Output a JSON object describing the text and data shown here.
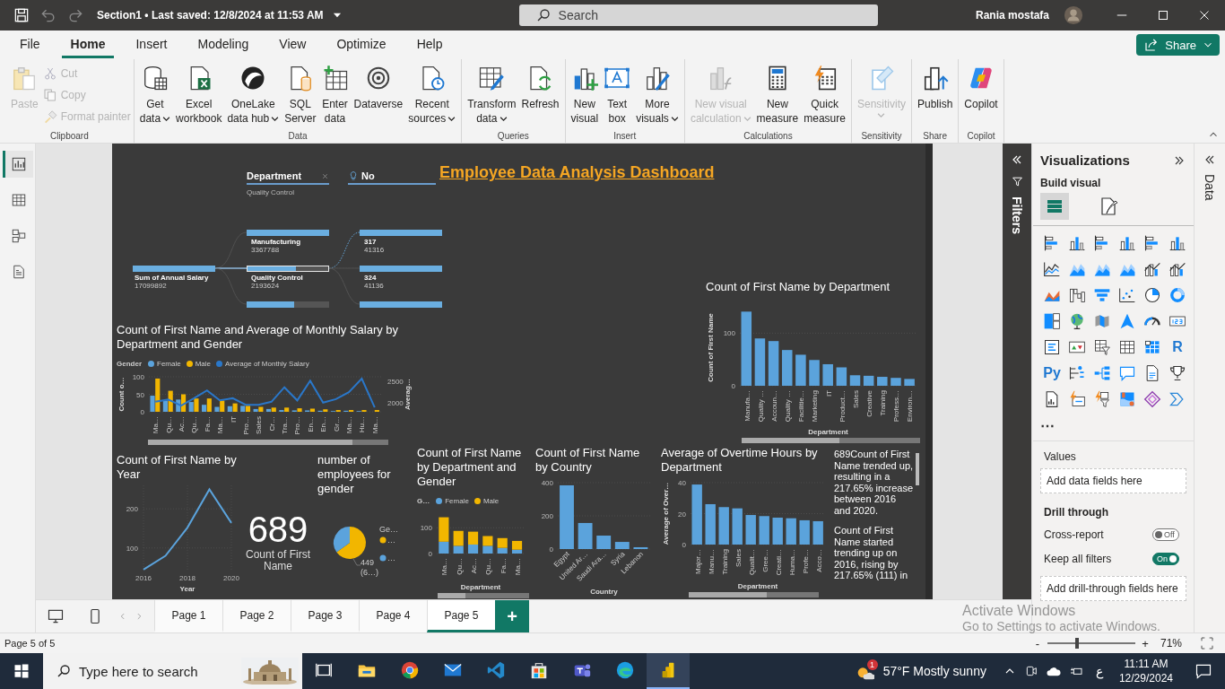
{
  "title_bar": {
    "document": "Section1",
    "separator": "•",
    "saved": "Last saved: 12/8/2024 at 11:53 AM",
    "search": {
      "placeholder": "Search"
    },
    "user": "Rania mostafa"
  },
  "menu_tabs": [
    {
      "label": "File",
      "selected": false
    },
    {
      "label": "Home",
      "selected": true
    },
    {
      "label": "Insert",
      "selected": false
    },
    {
      "label": "Modeling",
      "selected": false
    },
    {
      "label": "View",
      "selected": false
    },
    {
      "label": "Optimize",
      "selected": false
    },
    {
      "label": "Help",
      "selected": false
    }
  ],
  "share_button": {
    "label": "Share"
  },
  "ribbon": [
    {
      "label": "Clipboard",
      "items": [
        {
          "kind": "large",
          "lines": [
            "Paste"
          ],
          "dropdown": false,
          "disabled": true
        },
        {
          "kind": "small",
          "lines": [
            "Cut"
          ],
          "dropdown": false,
          "disabled": true
        },
        {
          "kind": "small",
          "lines": [
            "Copy"
          ],
          "dropdown": false,
          "disabled": true
        },
        {
          "kind": "small",
          "lines": [
            "Format painter"
          ],
          "dropdown": false,
          "disabled": true
        }
      ]
    },
    {
      "label": "Data",
      "items": [
        {
          "kind": "large",
          "lines": [
            "Get",
            "data"
          ],
          "dropdown": true,
          "disabled": false
        },
        {
          "kind": "large",
          "lines": [
            "Excel",
            "workbook"
          ],
          "dropdown": false,
          "disabled": false
        },
        {
          "kind": "large",
          "lines": [
            "OneLake",
            "data hub"
          ],
          "dropdown": true,
          "disabled": false
        },
        {
          "kind": "large",
          "lines": [
            "SQL",
            "Server"
          ],
          "dropdown": false,
          "disabled": false
        },
        {
          "kind": "large",
          "lines": [
            "Enter",
            "data"
          ],
          "dropdown": false,
          "disabled": false
        },
        {
          "kind": "large",
          "lines": [
            "Dataverse"
          ],
          "dropdown": false,
          "disabled": false
        },
        {
          "kind": "large",
          "lines": [
            "Recent",
            "sources"
          ],
          "dropdown": true,
          "disabled": false
        }
      ]
    },
    {
      "label": "Queries",
      "items": [
        {
          "kind": "large",
          "lines": [
            "Transform",
            "data"
          ],
          "dropdown": true,
          "disabled": false
        },
        {
          "kind": "large",
          "lines": [
            "Refresh"
          ],
          "dropdown": false,
          "disabled": false
        }
      ]
    },
    {
      "label": "Insert",
      "items": [
        {
          "kind": "large",
          "lines": [
            "New",
            "visual"
          ],
          "dropdown": false,
          "disabled": false
        },
        {
          "kind": "large",
          "lines": [
            "Text",
            "box"
          ],
          "dropdown": false,
          "disabled": false
        },
        {
          "kind": "large",
          "lines": [
            "More",
            "visuals"
          ],
          "dropdown": true,
          "disabled": false
        }
      ]
    },
    {
      "label": "Calculations",
      "items": [
        {
          "kind": "large",
          "lines": [
            "New visual",
            "calculation"
          ],
          "dropdown": true,
          "disabled": true
        },
        {
          "kind": "large",
          "lines": [
            "New",
            "measure"
          ],
          "dropdown": false,
          "disabled": false
        },
        {
          "kind": "large",
          "lines": [
            "Quick",
            "measure"
          ],
          "dropdown": false,
          "disabled": false
        }
      ]
    },
    {
      "label": "Sensitivity",
      "items": [
        {
          "kind": "large",
          "lines": [
            "Sensitivity"
          ],
          "dropdown": true,
          "disabled": true
        }
      ]
    },
    {
      "label": "Share",
      "items": [
        {
          "kind": "large",
          "lines": [
            "Publish"
          ],
          "dropdown": false,
          "disabled": false
        }
      ]
    },
    {
      "label": "Copilot",
      "items": [
        {
          "kind": "large",
          "lines": [
            "Copilot"
          ],
          "dropdown": false,
          "disabled": false
        }
      ]
    }
  ],
  "views": [
    {
      "selected": true
    },
    {
      "selected": false
    },
    {
      "selected": false
    },
    {
      "selected": false
    }
  ],
  "report": {
    "slicers": [
      {
        "kind": "list",
        "title": "Department",
        "value": "Quality Control",
        "clearable": true
      },
      {
        "kind": "bulb",
        "title": "No"
      }
    ],
    "title": "Employee Data Analysis Dashboard",
    "decomposition_tree": {
      "root": {
        "label": "Sum of Annual Salary",
        "value": "17099892",
        "level": 1
      },
      "columns": [
        {
          "items": [
            {
              "label": "Manufacturing",
              "value": "3367788",
              "level": 1,
              "selected": false
            },
            {
              "label": "Quality Control",
              "value": "2193624",
              "level": 0.6,
              "selected": true
            },
            {
              "level": 0.58,
              "selected": false
            }
          ]
        },
        {
          "items": [
            {
              "label": "317",
              "value": "41316",
              "level": 1
            },
            {
              "label": "324",
              "value": "41136",
              "level": 1
            },
            {
              "level": 1
            }
          ]
        }
      ]
    },
    "visuals": [
      {
        "kind": "chart",
        "title": "Count of First Name by Department",
        "chart_data": {
          "type": "bar",
          "grid": true,
          "ylabel": "Count of First Name",
          "xlabel": "Department",
          "categories": [
            "Manufa…",
            "Quality …",
            "Accoun…",
            "Quality …",
            "Facilitie…",
            "Marketing",
            "IT",
            "Product…",
            "Sales",
            "Creative",
            "Training",
            "Profess…",
            "Environ…"
          ],
          "series": [
            {
              "color": "#5ba3dc",
              "values": [
                141,
                90,
                85,
                68,
                59,
                49,
                41,
                35,
                20,
                19,
                17,
                15,
                13
              ]
            }
          ],
          "ylim": [
            0,
            145
          ],
          "yticks": [
            0,
            100
          ]
        }
      },
      {
        "kind": "chart",
        "title": "Count of First Name and Average of Monthly Salary by Department and Gender",
        "legend": {
          "title": "Gender"
        },
        "chart_data": {
          "type": "bar",
          "grid": true,
          "ylabel": "Count o…",
          "y2label": "Averag…",
          "categories": [
            "Ma…",
            "Qu…",
            "Ac…",
            "Qu…",
            "Fa…",
            "Ma…",
            "IT",
            "Pro…",
            "Sales",
            "Cr…",
            "Tra…",
            "Pro…",
            "En…",
            "En…",
            "Gr…",
            "Ma…",
            "Hu…",
            "Ma…"
          ],
          "series": [
            {
              "name": "Female",
              "color": "#5ba3dc",
              "values": [
                46,
                32,
                35,
                28,
                20,
                14,
                16,
                17,
                8,
                8,
                5,
                4,
                4,
                3,
                2,
                3,
                2,
                null
              ]
            },
            {
              "name": "Male",
              "color": "#f2b600",
              "values": [
                95,
                60,
                50,
                38,
                38,
                32,
                24,
                17,
                14,
                12,
                12,
                10,
                9,
                7,
                5,
                5,
                5,
                5
              ]
            },
            {
              "name": "Average of Monthly Salary",
              "type": "line",
              "axis": "y2",
              "color": "#2a77c9",
              "values": [
                2030,
                2080,
                1940,
                2110,
                2290,
                2060,
                2110,
                1960,
                1960,
                2030,
                2360,
                2060,
                2510,
                2010,
                2090,
                2250,
                2560,
                1900
              ]
            }
          ],
          "ylim": [
            0,
            100
          ],
          "yticks": [
            0,
            50,
            100
          ],
          "y2lim": [
            1800,
            2600
          ],
          "y2ticks": [
            2000,
            2500
          ]
        }
      },
      {
        "kind": "chart",
        "title": "Count of First Name by Year",
        "chart_data": {
          "type": "line",
          "grid": true,
          "xlabel": "Year",
          "x": [
            2016,
            2017,
            2018,
            2019,
            2020
          ],
          "series": [
            {
              "color": "#5ba3dc",
              "values": [
                45,
                80,
                152,
                250,
                164
              ]
            }
          ],
          "xlim": [
            2016,
            2020
          ],
          "ylim": [
            40,
            260
          ],
          "xticks": [
            2016,
            2018,
            2020
          ],
          "yticks": [
            100,
            200
          ]
        }
      },
      {
        "kind": "card",
        "value": "689",
        "label": "Count of First Name"
      },
      {
        "kind": "chart",
        "title": "number of employees for gender",
        "legend": {
          "title": "Ge…"
        },
        "chart_data": {
          "type": "pie",
          "categories": [
            "…",
            "…"
          ],
          "values": [
            65.17,
            34.83
          ],
          "colors": [
            "#f2b600",
            "#5ba3dc"
          ],
          "annotations": [
            "449",
            "(6…)"
          ]
        }
      },
      {
        "kind": "chart",
        "title": "Count of First Name by Department and Gender",
        "legend": {
          "title": "G…"
        },
        "chart_data": {
          "type": "bar",
          "grid": true,
          "stacked": true,
          "xlabel": "Department",
          "categories": [
            "Ma…",
            "Qu…",
            "Ac…",
            "Qu…",
            "Fa…",
            "Ma…"
          ],
          "series": [
            {
              "name": "Female",
              "color": "#5ba3dc",
              "values": [
                46,
                30,
                35,
                30,
                22,
                15
              ]
            },
            {
              "name": "Male",
              "color": "#f2b600",
              "values": [
                95,
                58,
                50,
                38,
                38,
                34
              ]
            }
          ],
          "ylim": [
            0,
            150
          ],
          "yticks": [
            0,
            100
          ]
        }
      },
      {
        "kind": "chart",
        "title": "Count of First Name by Country",
        "chart_data": {
          "type": "bar",
          "xlabel": "Country",
          "categories": [
            "Egypt",
            "United Ar…",
            "Saudi Ara…",
            "Syria",
            "Lebanon"
          ],
          "series": [
            {
              "color": "#5ba3dc",
              "values": [
                384,
                157,
                81,
                43,
                11
              ]
            }
          ],
          "grid": true,
          "ylim": [
            0,
            400
          ],
          "yticks": [
            0,
            200,
            400
          ]
        }
      },
      {
        "kind": "chart",
        "title": "Average of Overtime Hours by Department",
        "chart_data": {
          "type": "bar",
          "ylabel": "Average of Over…",
          "xlabel": "Department",
          "categories": [
            "Major…",
            "Manu…",
            "Training",
            "Sales",
            "Qualit…",
            "Gree…",
            "Creati…",
            "Huma…",
            "Profe…",
            "Acco…"
          ],
          "series": [
            {
              "color": "#5ba3dc",
              "values": [
                38.8,
                26.1,
                24.2,
                23.4,
                19.1,
                18.4,
                17.4,
                17,
                15.7,
                15.1
              ]
            }
          ],
          "grid": true,
          "ylim": [
            0,
            40
          ],
          "yticks": [
            0,
            20,
            40
          ]
        }
      },
      {
        "kind": "narrative",
        "paragraphs": [
          "689Count of First Name trended up, resulting in a 217.65% increase between 2016 and 2020.",
          "Count of First Name started trending up on 2016, rising by 217.65% (111) in"
        ]
      }
    ]
  },
  "filters_pane": {
    "label": "Filters"
  },
  "visualizations": {
    "title": "Visualizations",
    "subtitle": "Build visual",
    "tabs": [
      {
        "selected": true
      },
      {
        "selected": false
      }
    ],
    "gallery_text": [
      "R",
      "Py"
    ],
    "more": "⋯",
    "values": {
      "label": "Values",
      "well": "Add data fields here"
    },
    "drill_through": {
      "title": "Drill through",
      "toggles": [
        {
          "label": "Cross-report",
          "on": false,
          "text": "Off"
        },
        {
          "label": "Keep all filters",
          "on": true,
          "text": "On"
        }
      ],
      "well": "Add drill-through fields here"
    }
  },
  "data_pane": {
    "label": "Data"
  },
  "pages": [
    {
      "label": "Page 1",
      "selected": false
    },
    {
      "label": "Page 2",
      "selected": false
    },
    {
      "label": "Page 3",
      "selected": false
    },
    {
      "label": "Page 4",
      "selected": false
    },
    {
      "label": "Page 5",
      "selected": true
    }
  ],
  "add_page": "+",
  "status_bar": {
    "page": "Page 5 of 5",
    "zoom": {
      "minus": "-",
      "plus": "+",
      "level": 0.34,
      "value": "71%"
    }
  },
  "activation_notice": {
    "title": "Activate Windows",
    "text": "Go to Settings to activate Windows."
  },
  "taskbar": {
    "search": {
      "placeholder": "Type here to search"
    },
    "apps": [
      {
        "selected": false
      },
      {
        "selected": false
      },
      {
        "selected": false
      },
      {
        "selected": false
      },
      {
        "selected": false
      },
      {
        "selected": false
      },
      {
        "selected": false
      },
      {
        "selected": false
      },
      {
        "selected": true
      }
    ],
    "weather": {
      "badge": "1",
      "temperature": "57°F",
      "condition": "Mostly sunny"
    },
    "language": "ع",
    "time": "11:11 AM",
    "date": "12/29/2024"
  }
}
